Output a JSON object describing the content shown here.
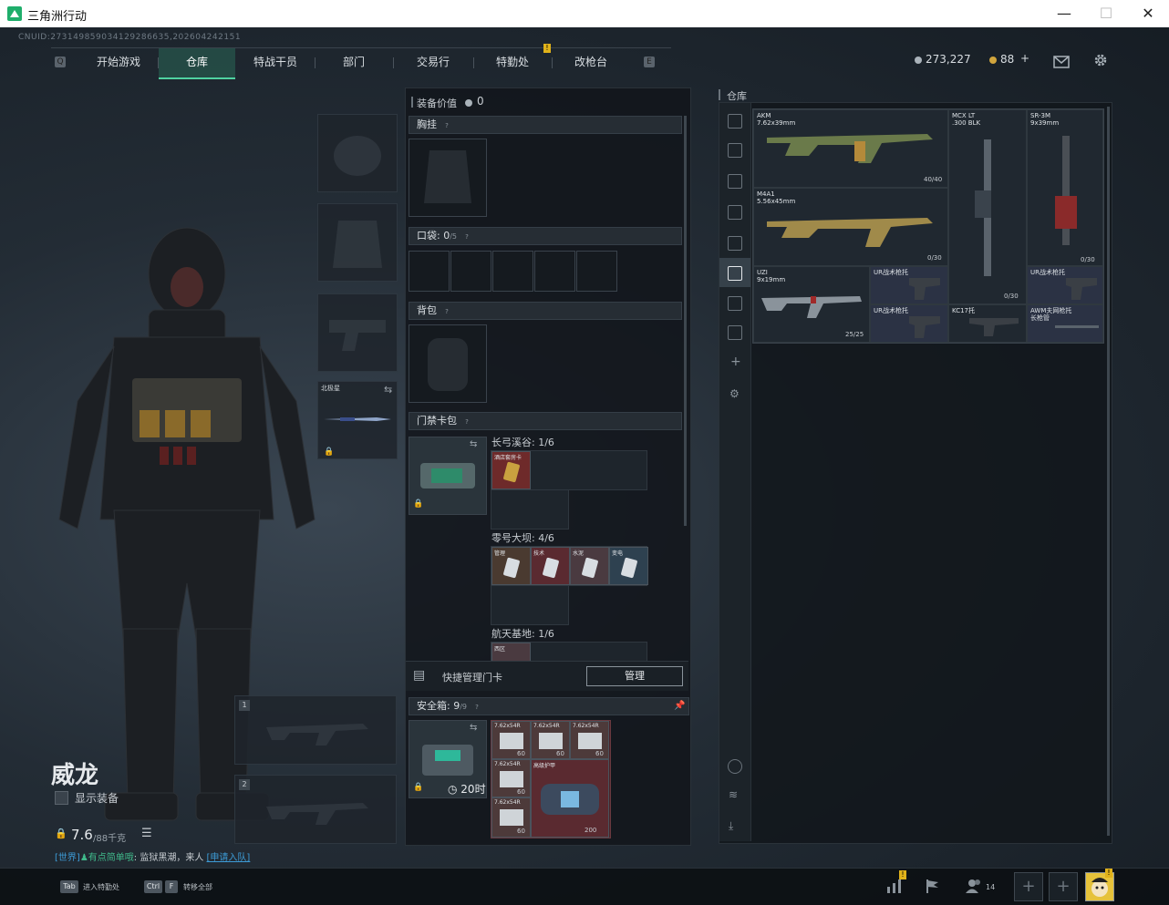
{
  "window": {
    "title": "三角洲行动",
    "minimize": "—",
    "maximize": "☐",
    "close": "✕"
  },
  "uid": "CNUID:273149859034129286635,202604242151",
  "nav": {
    "left_key": "Q",
    "right_key": "E",
    "tabs": [
      "开始游戏",
      "仓库",
      "特战干员",
      "部门",
      "交易行",
      "特勤处",
      "改枪台"
    ],
    "active_tab": "仓库",
    "notif_mark": "!"
  },
  "currency": {
    "silver": "273,227",
    "gold": "88",
    "add": "+"
  },
  "operator": {
    "name": "威龙",
    "show_equipment": "显示装备",
    "weight": "7.6",
    "weight_max": "/88千克"
  },
  "chat": {
    "channel": "[世界]",
    "user": "♟有点简单哦",
    "message": ": 监狱黑潮，来人",
    "link": "[申请入队]"
  },
  "equipment": {
    "knife_label": "北极星",
    "slot1": "1",
    "slot2": "2"
  },
  "center": {
    "value_label": "装备价值",
    "value": "0",
    "chest_rig": "胸挂",
    "pockets": "口袋:",
    "pockets_count": "0",
    "pockets_max": "/5",
    "backpack": "背包",
    "keycard_pack": "门禁卡包",
    "maps": [
      {
        "name": "长弓溪谷: 1/6",
        "cards": [
          "酒店套房卡"
        ]
      },
      {
        "name": "零号大坝: 4/6",
        "cards": [
          "管理",
          "技术",
          "水泥",
          "变电"
        ]
      },
      {
        "name": "航天基地: 1/6",
        "cards": [
          "西区"
        ]
      }
    ],
    "quick_manage": "快捷管理门卡",
    "manage_btn": "管理",
    "safebox": "安全箱:",
    "safebox_count": "9",
    "safebox_max": "/9",
    "safebox_timer": "20时",
    "ammo_label": "7.62x54R",
    "ammo_count": "60",
    "armor_label": "高级护甲",
    "armor_value": "200"
  },
  "warehouse": {
    "title": "仓库",
    "items": [
      {
        "name": "AKM",
        "caliber": "7.62x39mm",
        "count": "40/40"
      },
      {
        "name": "MCX LT",
        "caliber": ".300 BLK",
        "count": "0/30"
      },
      {
        "name": "SR-3M",
        "caliber": "9x39mm",
        "count": "0/30"
      },
      {
        "name": "M4A1",
        "caliber": "5.56x45mm",
        "count": "0/30"
      },
      {
        "name": "UZI",
        "caliber": "9x19mm",
        "count": "25/25"
      },
      {
        "name": "UR战术枪托",
        "caliber": "",
        "count": ""
      },
      {
        "name": "UR战术枪托",
        "caliber": "",
        "count": ""
      },
      {
        "name": "UR战术枪托",
        "caliber": "",
        "count": ""
      },
      {
        "name": "KC17托",
        "caliber": "",
        "count": ""
      },
      {
        "name": "AWM夫网枪托",
        "caliber": "长枪管",
        "count": ""
      }
    ]
  },
  "bottom": {
    "tab_key": "Tab",
    "tab_label": "进入特勤处",
    "ctrl_key": "Ctrl",
    "f_key": "F",
    "f_label": "转移全部",
    "friends_count": "14",
    "plus": "+"
  },
  "colors": {
    "accent": "#4fd1a0",
    "notif": "#e0b21a",
    "panel": "#12161b"
  }
}
